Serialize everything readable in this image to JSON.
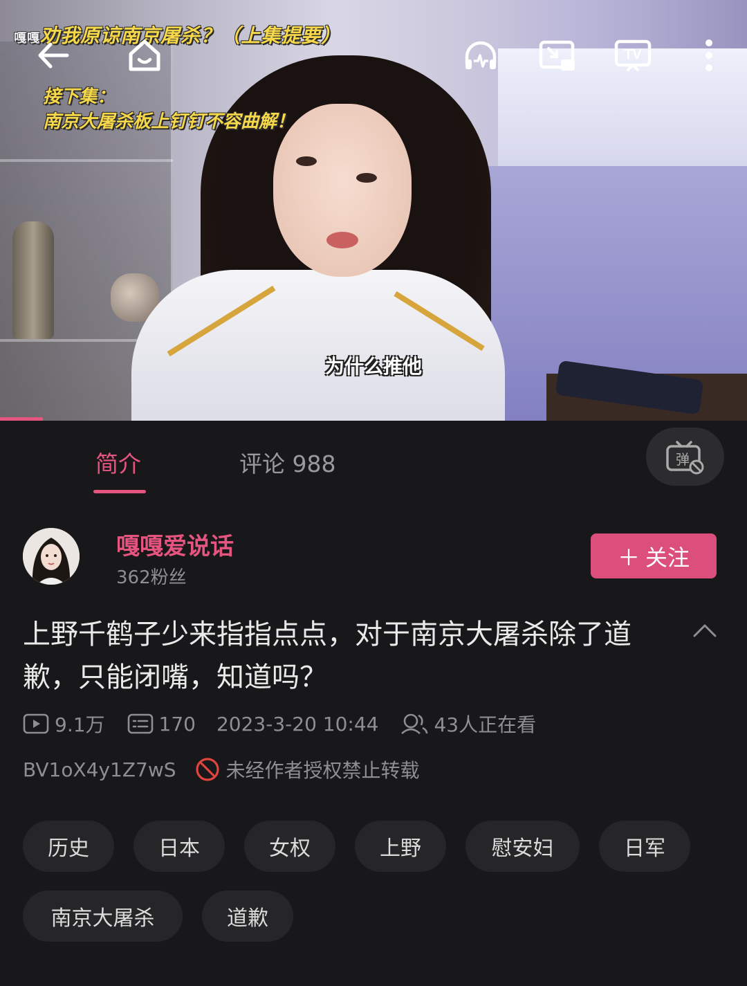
{
  "video": {
    "overlay_prefix": "嘎嘎",
    "overlay_title": "劝我原谅南京屠杀？（上集提要）",
    "overlay_next_label": "接下集：",
    "overlay_next_text": "南京大屠杀板上钉钉不容曲解！",
    "subtitle": "为什么推他",
    "progress_fraction": 0.057
  },
  "topbar": {
    "icons": [
      "back-arrow-icon",
      "home-icon",
      "headphones-icon",
      "picture-in-picture-icon",
      "tv-cast-icon",
      "more-vertical-icon"
    ]
  },
  "tabs": {
    "intro": "简介",
    "comments": "评论 988",
    "danmaku_glyph": "弹"
  },
  "author": {
    "name": "嘎嘎爱说话",
    "fans": "362粉丝",
    "follow_label": "关注",
    "follow_plus": "＋"
  },
  "video_info": {
    "title": "上野千鹤子少来指指点点，对于南京大屠杀除了道歉，只能闭嘴，知道吗？",
    "views": "9.1万",
    "danmaku_count": "170",
    "publish_time": "2023-3-20 10:44",
    "watching": "43人正在看",
    "bvid": "BV1oX4y1Z7wS",
    "copyright_notice": "未经作者授权禁止转载"
  },
  "tags": [
    "历史",
    "日本",
    "女权",
    "上野",
    "慰安妇",
    "日军",
    "南京大屠杀",
    "道歉"
  ],
  "colors": {
    "accent": "#e5557f",
    "follow_button": "#dc4f7c",
    "background": "#18181a",
    "tag_background": "#262628",
    "copyright_icon": "#e0443e"
  }
}
